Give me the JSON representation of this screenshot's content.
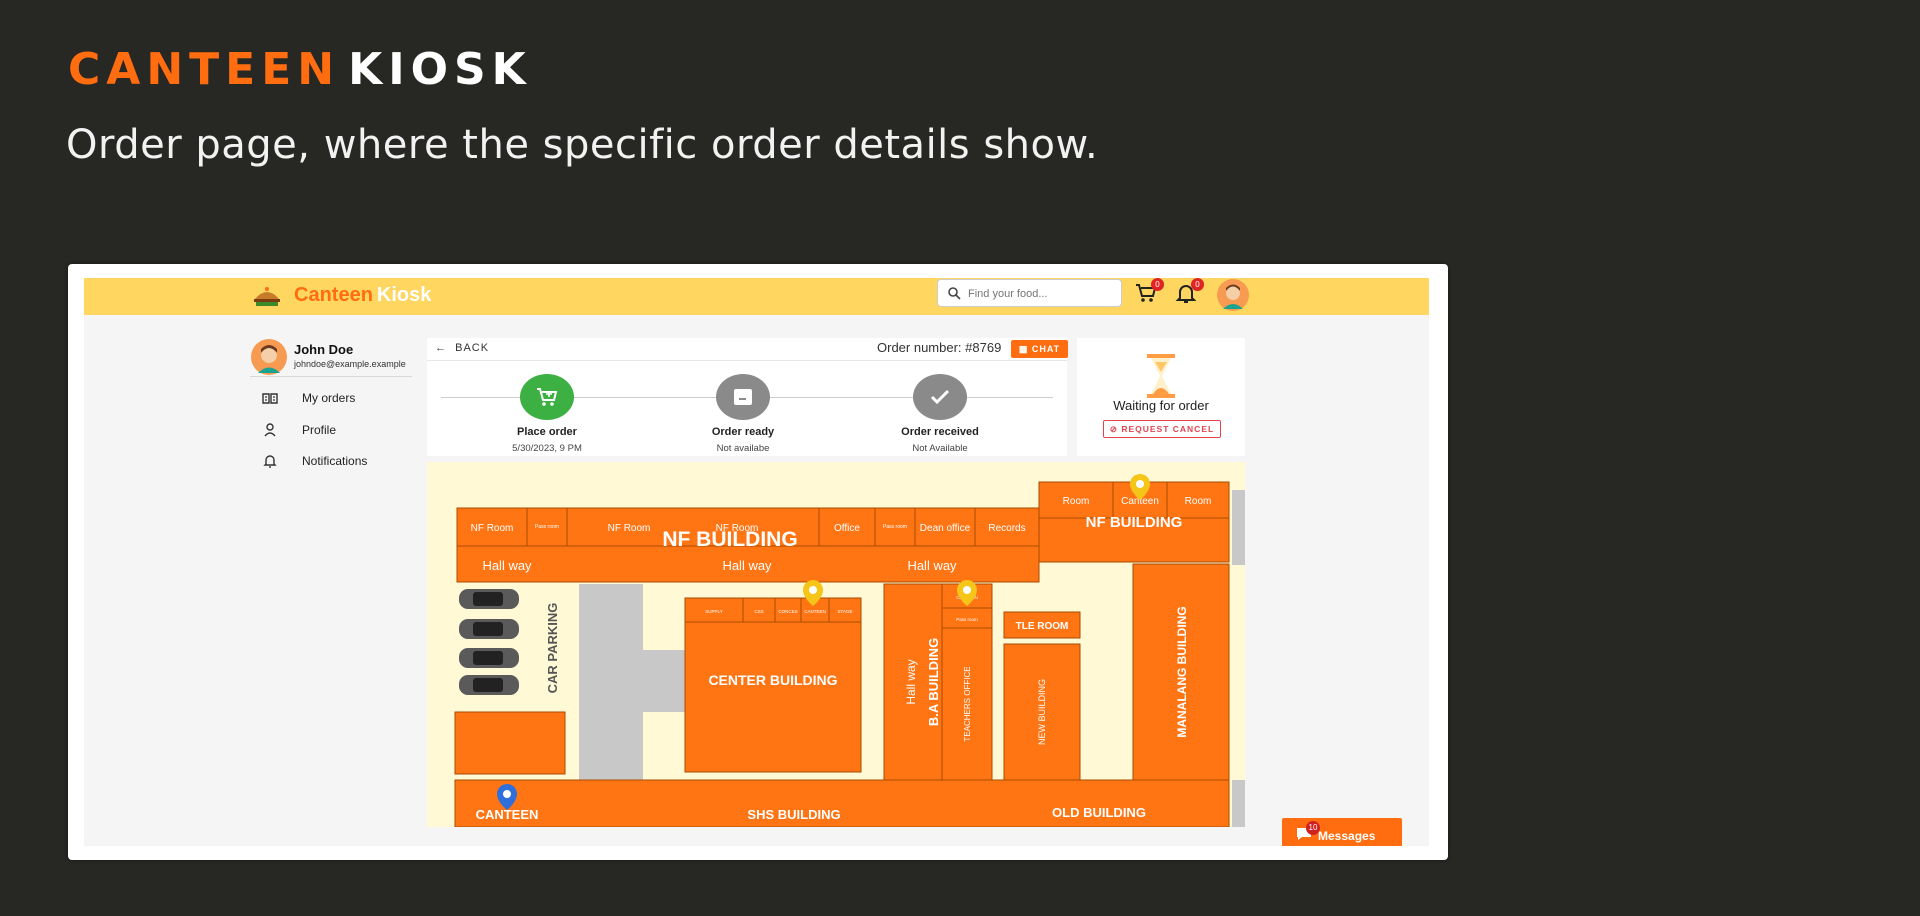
{
  "slide": {
    "brand_part1": "CANTEEN",
    "brand_part2": "KIOSK",
    "subtitle": "Order page, where the specific order details show."
  },
  "app": {
    "logo_part1": "Canteen",
    "logo_part2": "Kiosk",
    "search_placeholder": "Find your food...",
    "cart_count": "0",
    "notif_count": "0"
  },
  "sidebar": {
    "user_name": "John Doe",
    "user_email": "johndoe@example.example",
    "items": [
      {
        "label": "My orders",
        "icon": "orders-icon"
      },
      {
        "label": "Profile",
        "icon": "profile-icon"
      },
      {
        "label": "Notifications",
        "icon": "bell-icon"
      }
    ]
  },
  "order": {
    "back_label": "BACK",
    "order_number": "Order number: #8769",
    "chat_label": "CHAT",
    "steps": [
      {
        "title": "Place order",
        "detail": "5/30/2023, 9 PM",
        "color": "#3cb043",
        "icon": "cart-icon"
      },
      {
        "title": "Order ready",
        "detail": "Not availabe",
        "color": "#8a8a8a",
        "icon": "tray-icon"
      },
      {
        "title": "Order received",
        "detail": "Not Available",
        "color": "#8a8a8a",
        "icon": "check-icon"
      }
    ],
    "status_text": "Waiting for order",
    "request_cancel_label": "REQUEST CANCEL"
  },
  "map": {
    "nf_building_top": "NF BUILDING",
    "nf_building_right": "NF BUILDING",
    "nf_rooms": [
      "NF Room",
      "Pass room",
      "NF Room",
      "NF Room",
      "Office",
      "Pass room",
      "Dean office",
      "Records"
    ],
    "right_rooms": [
      "Room",
      "Canteen",
      "Room"
    ],
    "hallways": [
      "Hall way",
      "Hall way",
      "Hall way"
    ],
    "car_parking": "CAR PARKING",
    "center_building": "CENTER BUILDING",
    "center_rooms": [
      "SUPPLY",
      "CSS",
      "CONCES",
      "CANTEEN",
      "STAGE"
    ],
    "ba_hall": "Hall way",
    "ba_building": "B.A BUILDING",
    "ba_small": [
      "CANTEEN",
      "Pass room"
    ],
    "teachers_office": "TEACHERS OFFICE",
    "tle_room": "TLE ROOM",
    "new_building": "NEW BUILDING",
    "manalang_building": "MANALANG BUILDING",
    "canteen_label": "CANTEEN",
    "shs_building": "SHS BUILDING",
    "old_building": "OLD BUILDING",
    "building_color": "#ff7514",
    "pin_color": "#f5c518",
    "current_pin_color": "#2f6fdc"
  },
  "messages": {
    "label": "Messages",
    "count": "10"
  },
  "colors": {
    "background": "#272723",
    "accent": "#ff6d10",
    "topbar": "#ffd660"
  }
}
